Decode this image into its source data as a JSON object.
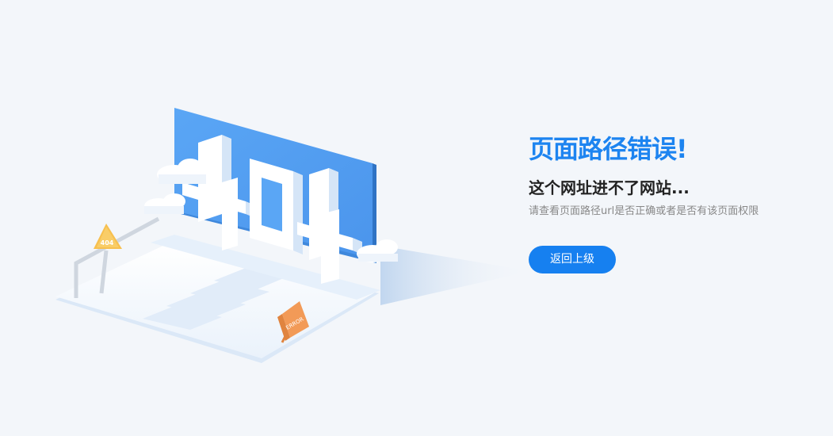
{
  "error": {
    "title": "页面路径错误!",
    "subtitle": "这个网址进不了网站...",
    "description": "请查看页面路径url是否正确或者是否有该页面权限",
    "back_button_label": "返回上级"
  },
  "illustration": {
    "big_text": "404",
    "sign_text": "404",
    "board_text": "ERROR",
    "icon": "error-404-laptop-illustration"
  },
  "colors": {
    "accent": "#1680f0",
    "title": "#1d84f0",
    "background": "#f3f6fa",
    "screen": "#5aa6f5",
    "warning_sign": "#f7c04f",
    "error_board": "#f29a57"
  }
}
